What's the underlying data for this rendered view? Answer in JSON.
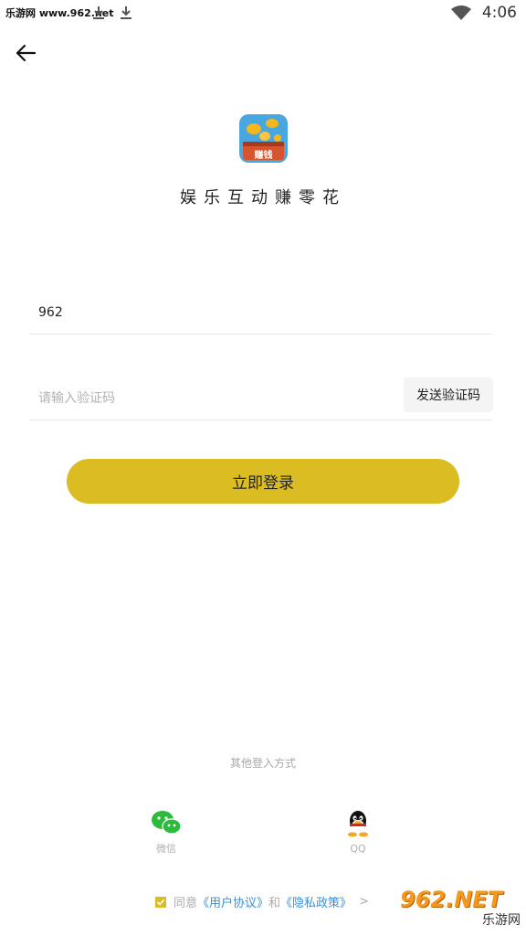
{
  "status": {
    "site": "乐游网 www.962.net",
    "time": "4:06"
  },
  "app": {
    "name": "娱乐互动赚零花",
    "logo_label": "赚钱",
    "logo_colors": {
      "sky": "#4aa6df",
      "chest": "#d7552e",
      "coin": "#f5b81c"
    }
  },
  "form": {
    "phone_value": "962",
    "code_placeholder": "请输入验证码",
    "send_code_label": "发送验证码",
    "login_label": "立即登录"
  },
  "other_login": {
    "title": "其他登入方式",
    "wechat_label": "微信",
    "qq_label": "QQ"
  },
  "agreement": {
    "checked": true,
    "prefix": "同意",
    "user_agreement": "《用户协议》",
    "and": "和",
    "privacy_policy": "《隐私政策》",
    "chevron": ">"
  },
  "watermark": {
    "brand": "962.NET",
    "caption": "乐游网"
  },
  "colors": {
    "accent": "#dbbc23",
    "link": "#3a8fd9",
    "muted": "#aaaaaa"
  },
  "icons": [
    "download-icon",
    "wifi-icon",
    "back-arrow-icon",
    "wechat-icon",
    "qq-icon",
    "check-icon"
  ]
}
